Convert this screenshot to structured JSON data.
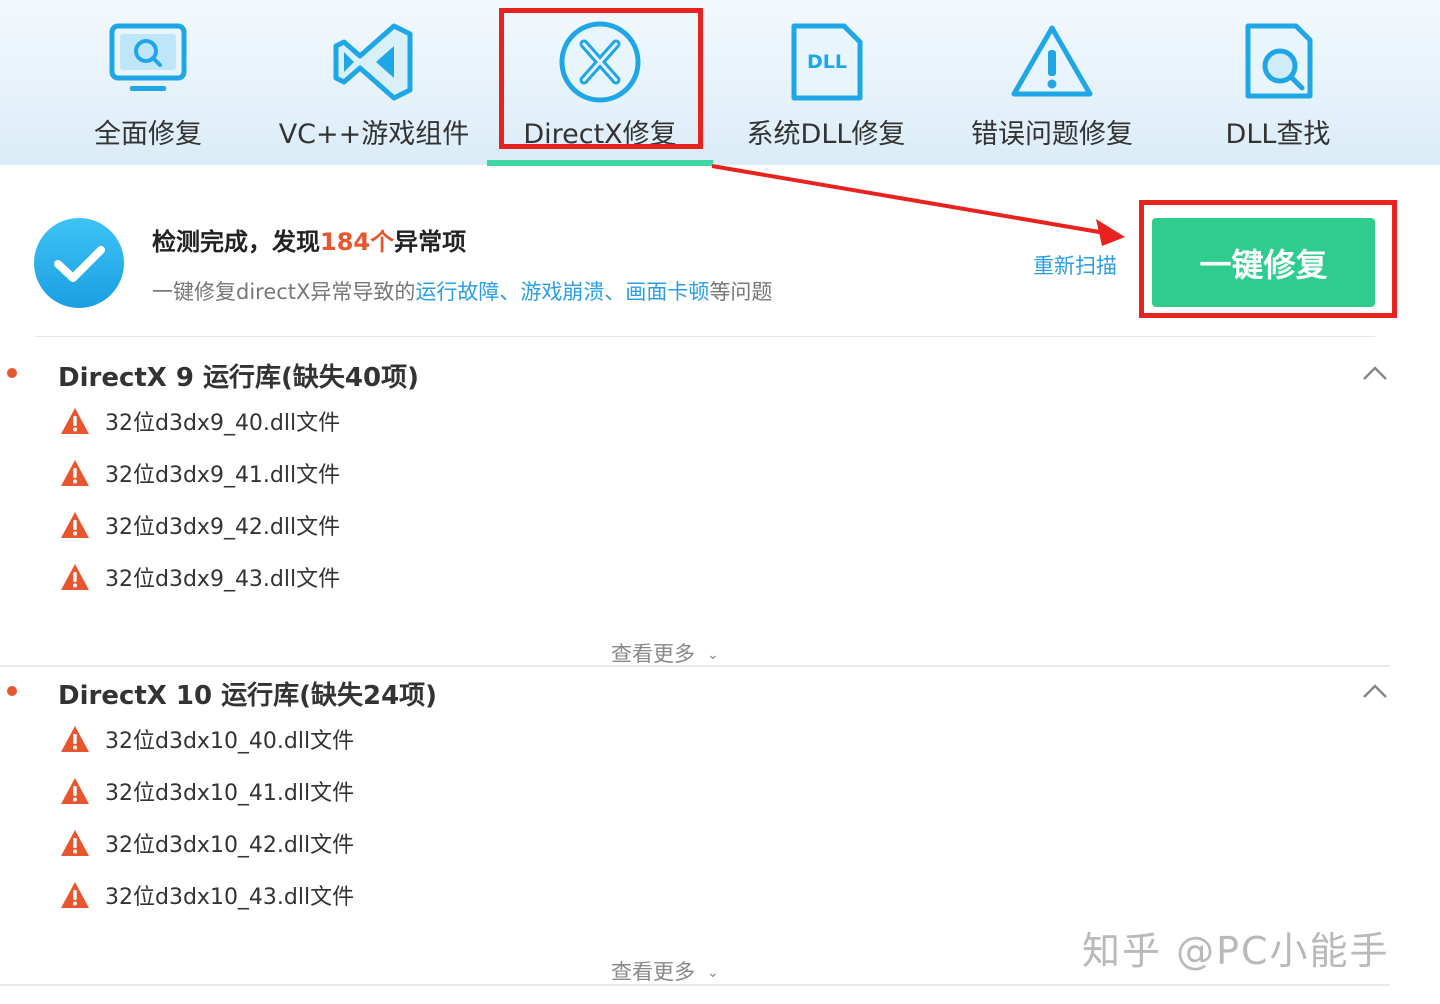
{
  "tabs": [
    {
      "label": "全面修复",
      "icon": "monitor-search-icon"
    },
    {
      "label": "VC++游戏组件",
      "icon": "visual-studio-icon"
    },
    {
      "label": "DirectX修复",
      "icon": "directx-icon"
    },
    {
      "label": "系统DLL修复",
      "icon": "dll-file-icon"
    },
    {
      "label": "错误问题修复",
      "icon": "warning-icon"
    },
    {
      "label": "DLL查找",
      "icon": "file-search-icon"
    }
  ],
  "summary": {
    "headline_prefix": "检测完成，发现",
    "count": "184个",
    "headline_suffix": "异常项",
    "sub_prefix": "一键修复directX异常导致的",
    "sub_links": "运行故障、游戏崩溃、画面卡顿",
    "sub_suffix": "等问题",
    "rescan": "重新扫描",
    "repair": "一键修复"
  },
  "sections": [
    {
      "title": "DirectX 9 运行库(缺失40项)",
      "items": [
        "32位d3dx9_40.dll文件",
        "32位d3dx9_41.dll文件",
        "32位d3dx9_42.dll文件",
        "32位d3dx9_43.dll文件"
      ],
      "more": "查看更多"
    },
    {
      "title": "DirectX 10 运行库(缺失24项)",
      "items": [
        "32位d3dx10_40.dll文件",
        "32位d3dx10_41.dll文件",
        "32位d3dx10_42.dll文件",
        "32位d3dx10_43.dll文件"
      ],
      "more": "查看更多"
    }
  ],
  "watermark": "知乎 @PC小能手",
  "colors": {
    "accent_green": "#2ecc8f",
    "tab_underline": "#3fd6a6",
    "link_blue": "#2a9ee5",
    "alert_orange": "#e8562f",
    "annotation_red": "#e8231f"
  }
}
